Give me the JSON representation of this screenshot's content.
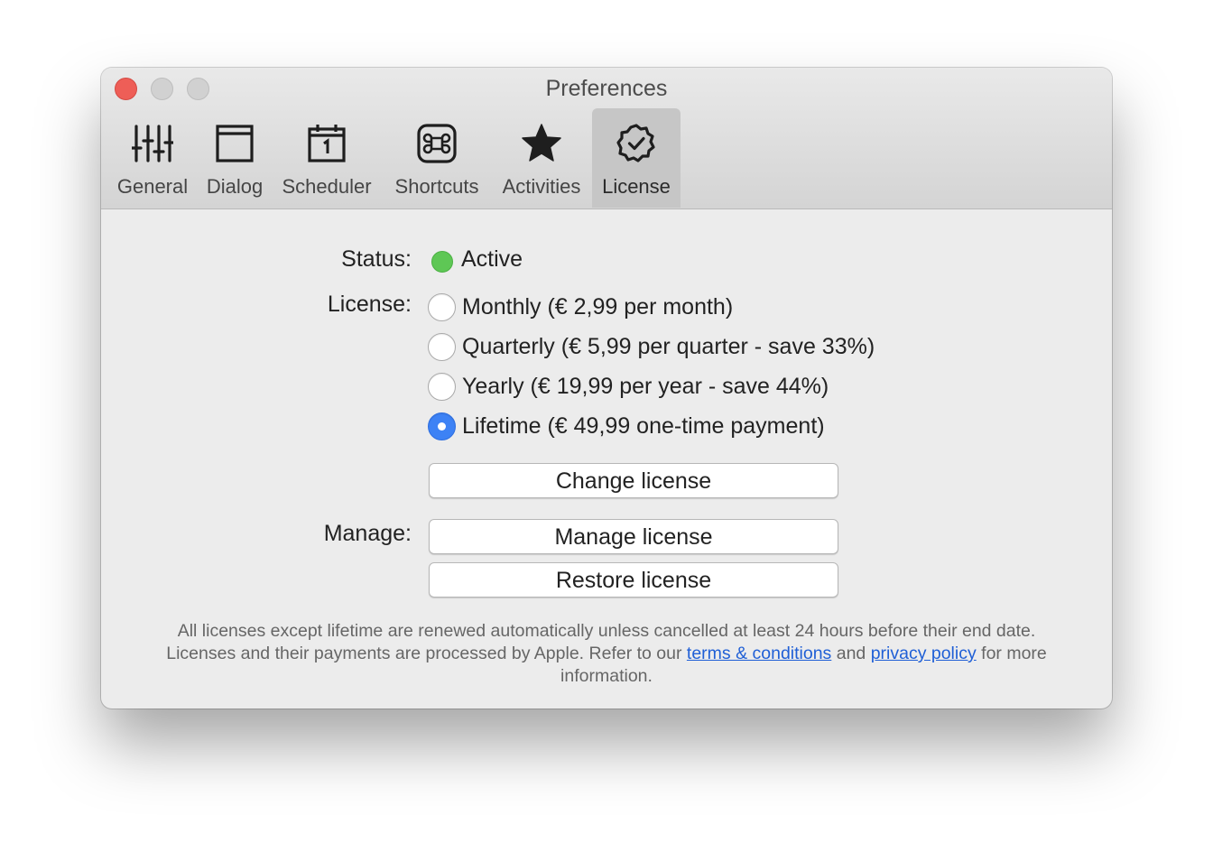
{
  "window": {
    "title": "Preferences"
  },
  "toolbar": {
    "tabs": [
      {
        "label": "General",
        "icon": "sliders-icon"
      },
      {
        "label": "Dialog",
        "icon": "window-icon"
      },
      {
        "label": "Scheduler",
        "icon": "calendar-icon"
      },
      {
        "label": "Shortcuts",
        "icon": "command-key-icon"
      },
      {
        "label": "Activities",
        "icon": "star-icon"
      },
      {
        "label": "License",
        "icon": "checkmark-seal-icon"
      }
    ],
    "selected_tab": "License"
  },
  "license": {
    "status_label": "Status:",
    "status_value": "Active",
    "status_color": "#5ec755",
    "license_label": "License:",
    "options": [
      {
        "label": "Monthly (€ 2,99 per month)",
        "selected": false
      },
      {
        "label": "Quarterly (€ 5,99 per quarter - save 33%)",
        "selected": false
      },
      {
        "label": "Yearly (€ 19,99 per year - save 44%)",
        "selected": false
      },
      {
        "label": "Lifetime (€ 49,99 one-time payment)",
        "selected": true
      }
    ],
    "change_button": "Change license",
    "manage_label": "Manage:",
    "manage_button": "Manage license",
    "restore_button": "Restore license"
  },
  "footer": {
    "line1": "All licenses except lifetime are renewed automatically unless cancelled at least 24 hours before their end date.",
    "line2_prefix": "Licenses and their payments are processed by Apple. Refer to our ",
    "terms_link": "terms & conditions",
    "and_text": " and ",
    "privacy_link": "privacy policy",
    "line2_suffix": " for more information."
  },
  "colors": {
    "accent": "#3d82f5",
    "link": "#1f5fd6",
    "close": "#ee5e57"
  }
}
